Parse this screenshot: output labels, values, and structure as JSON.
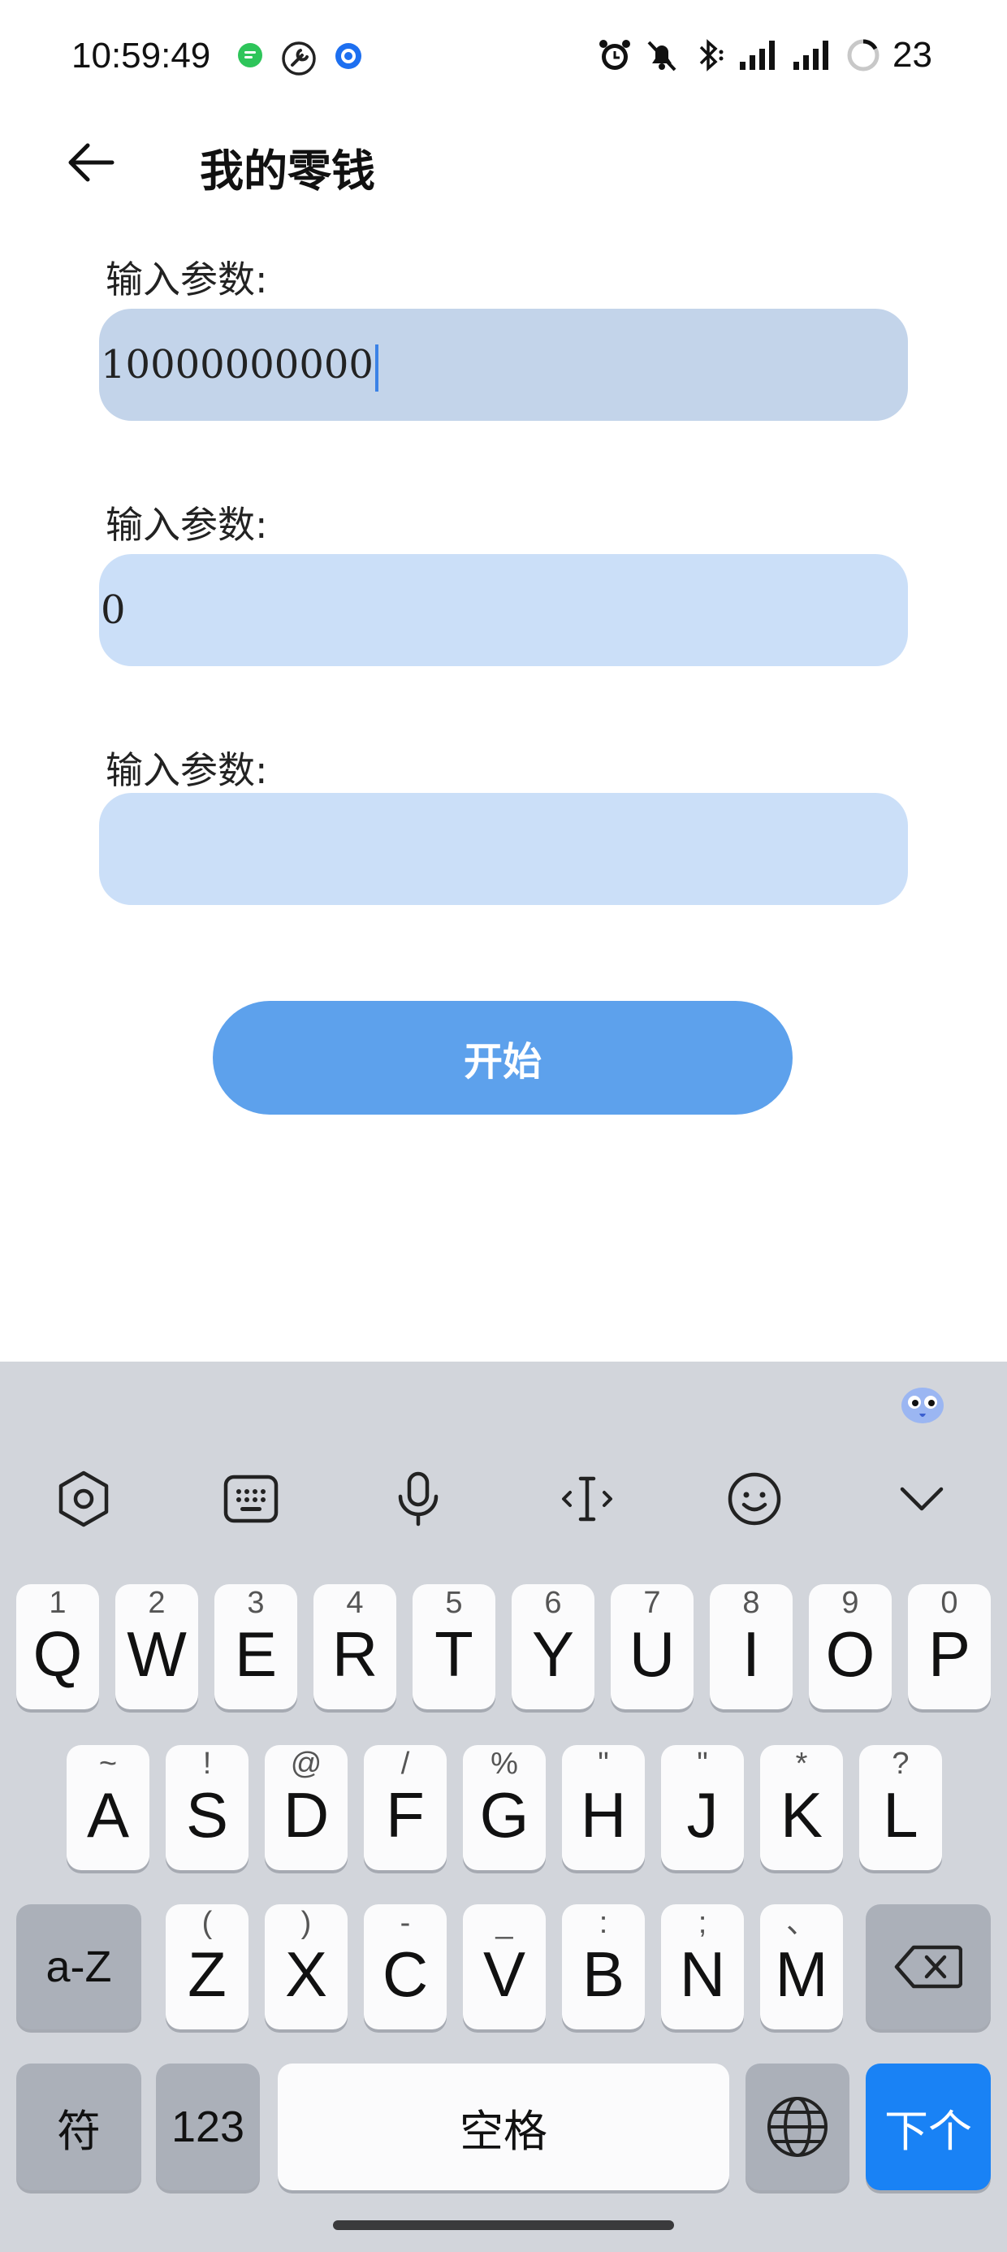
{
  "status_bar": {
    "time": "10:59:49",
    "battery": "23",
    "left_icons": [
      "message-app-icon",
      "wrench-icon",
      "notification-app-icon"
    ],
    "right_icons": [
      "alarm-icon",
      "mute-bell-icon",
      "bluetooth-icon",
      "signal-icon",
      "signal-icon",
      "battery-ring-icon"
    ]
  },
  "header": {
    "title": "我的零钱"
  },
  "form": {
    "fields": [
      {
        "label": "输入参数:",
        "value": "10000000000"
      },
      {
        "label": "输入参数:",
        "value": "0"
      },
      {
        "label": "输入参数:",
        "value": ""
      }
    ],
    "start_label": "开始"
  },
  "keyboard": {
    "row1": [
      {
        "main": "Q",
        "sub": "1"
      },
      {
        "main": "W",
        "sub": "2"
      },
      {
        "main": "E",
        "sub": "3"
      },
      {
        "main": "R",
        "sub": "4"
      },
      {
        "main": "T",
        "sub": "5"
      },
      {
        "main": "Y",
        "sub": "6"
      },
      {
        "main": "U",
        "sub": "7"
      },
      {
        "main": "I",
        "sub": "8"
      },
      {
        "main": "O",
        "sub": "9"
      },
      {
        "main": "P",
        "sub": "0"
      }
    ],
    "row2": [
      {
        "main": "A",
        "sub": "~"
      },
      {
        "main": "S",
        "sub": "!"
      },
      {
        "main": "D",
        "sub": "@"
      },
      {
        "main": "F",
        "sub": "/"
      },
      {
        "main": "G",
        "sub": "%"
      },
      {
        "main": "H",
        "sub": "\""
      },
      {
        "main": "J",
        "sub": "\""
      },
      {
        "main": "K",
        "sub": "*"
      },
      {
        "main": "L",
        "sub": "?"
      }
    ],
    "row3": [
      {
        "main": "Z",
        "sub": "("
      },
      {
        "main": "X",
        "sub": ")"
      },
      {
        "main": "C",
        "sub": "-"
      },
      {
        "main": "V",
        "sub": "_"
      },
      {
        "main": "B",
        "sub": ":"
      },
      {
        "main": "N",
        "sub": ";"
      },
      {
        "main": "M",
        "sub": "、"
      }
    ],
    "case_label": "a-Z",
    "symbol_label": "符",
    "numbers_label": "123",
    "space_label": "空格",
    "next_label": "下个",
    "accent_color": "#1982f5"
  }
}
